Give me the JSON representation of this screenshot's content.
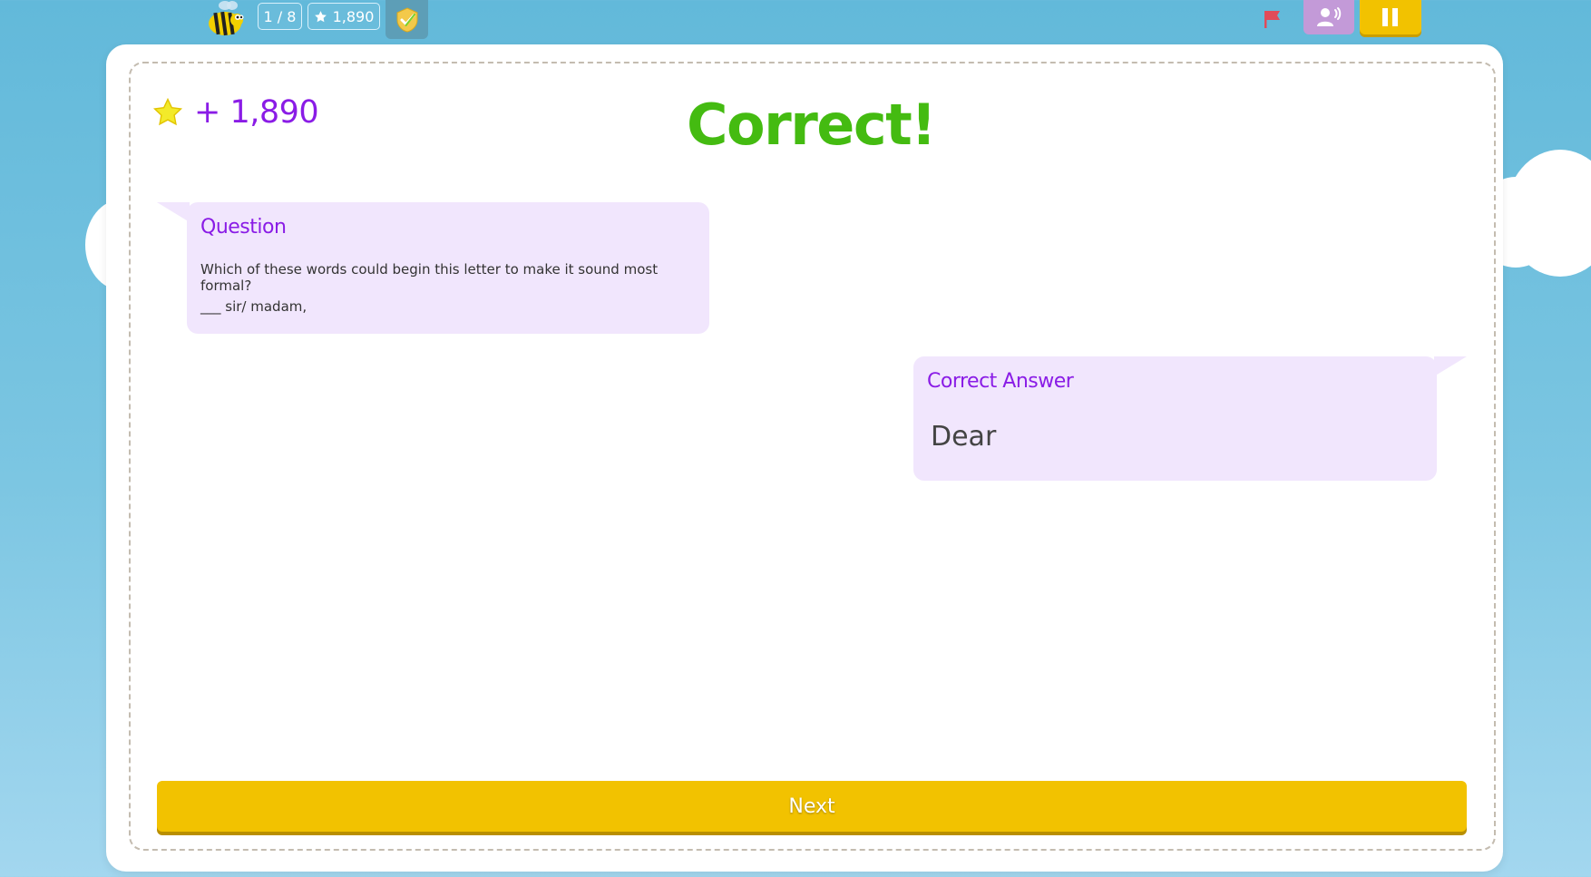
{
  "top_bar": {
    "progress": "1 / 8",
    "score": "1,890",
    "score_icon": "star-icon",
    "buttons": [
      "flag-icon",
      "listen-icon",
      "pause-icon"
    ]
  },
  "result": {
    "points_awarded": "+ 1,890",
    "title": "Correct!"
  },
  "question": {
    "heading": "Question",
    "text": "Which of these words could begin this letter to make it sound most formal?",
    "blank_line": "___ sir/ madam,"
  },
  "answer": {
    "heading": "Correct Answer",
    "value": "Dear"
  },
  "next_label": "Next",
  "colors": {
    "sky": "#62b9da",
    "success": "#44bb11",
    "accent_purple": "#8a1ce6",
    "bubble": "#f1e6fd",
    "button_yellow": "#f2c200",
    "listen_purple": "#c39ad8"
  }
}
